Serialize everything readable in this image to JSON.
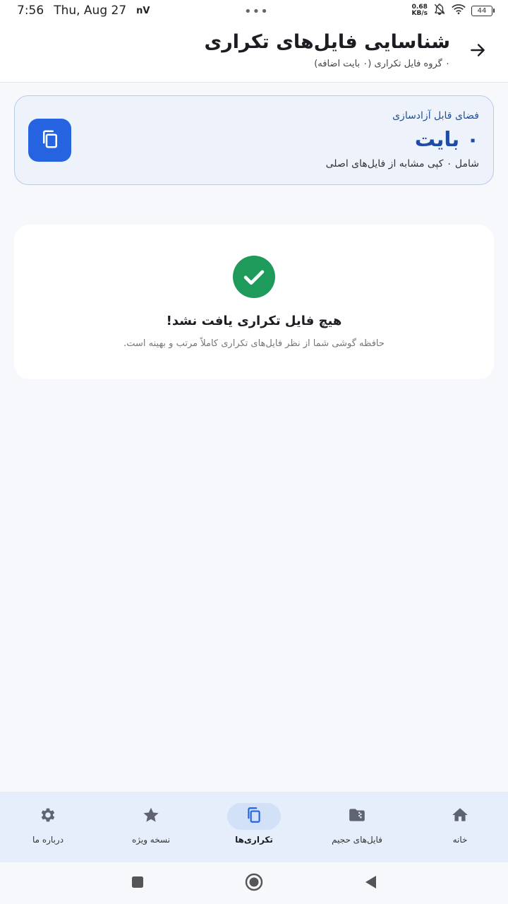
{
  "status_bar": {
    "time": "7:56",
    "date": "Thu, Aug 27",
    "carrier_badge": "nV",
    "center_dots": "•••",
    "net_speed_value": "0.68",
    "net_speed_unit": "KB/s",
    "battery": "44"
  },
  "header": {
    "title": "شناسایی فایل‌های تکراری",
    "subtitle": "۰ گروه فایل تکراری (۰ بایت اضافه)",
    "back_icon": "arrow-back-icon"
  },
  "summary": {
    "label": "فضای قابل آزادسازی",
    "value": "۰ بایت",
    "note": "شامل ۰ کپی مشابه از فایل‌های اصلی",
    "icon": "copy-icon",
    "accent_color": "#2563e0"
  },
  "empty_state": {
    "icon": "check-circle-icon",
    "title": "هیچ فایل تکراری یافت نشد!",
    "description": "حافظه گوشی شما از نظر فایل‌های تکراری کاملاً مرتب و بهینه است.",
    "success_color": "#1e9b5a"
  },
  "bottom_nav": {
    "items": [
      {
        "label": "خانه",
        "icon": "home-icon",
        "active": false
      },
      {
        "label": "فایل‌های حجیم",
        "icon": "folder-zip-icon",
        "active": false
      },
      {
        "label": "تکراری‌ها",
        "icon": "copy-icon",
        "active": true
      },
      {
        "label": "نسخه ویژه",
        "icon": "star-icon",
        "active": false
      },
      {
        "label": "درباره ما",
        "icon": "gear-icon",
        "active": false
      }
    ]
  },
  "system_nav": {
    "buttons": [
      "recents-icon",
      "home-circle-icon",
      "back-triangle-icon"
    ]
  }
}
